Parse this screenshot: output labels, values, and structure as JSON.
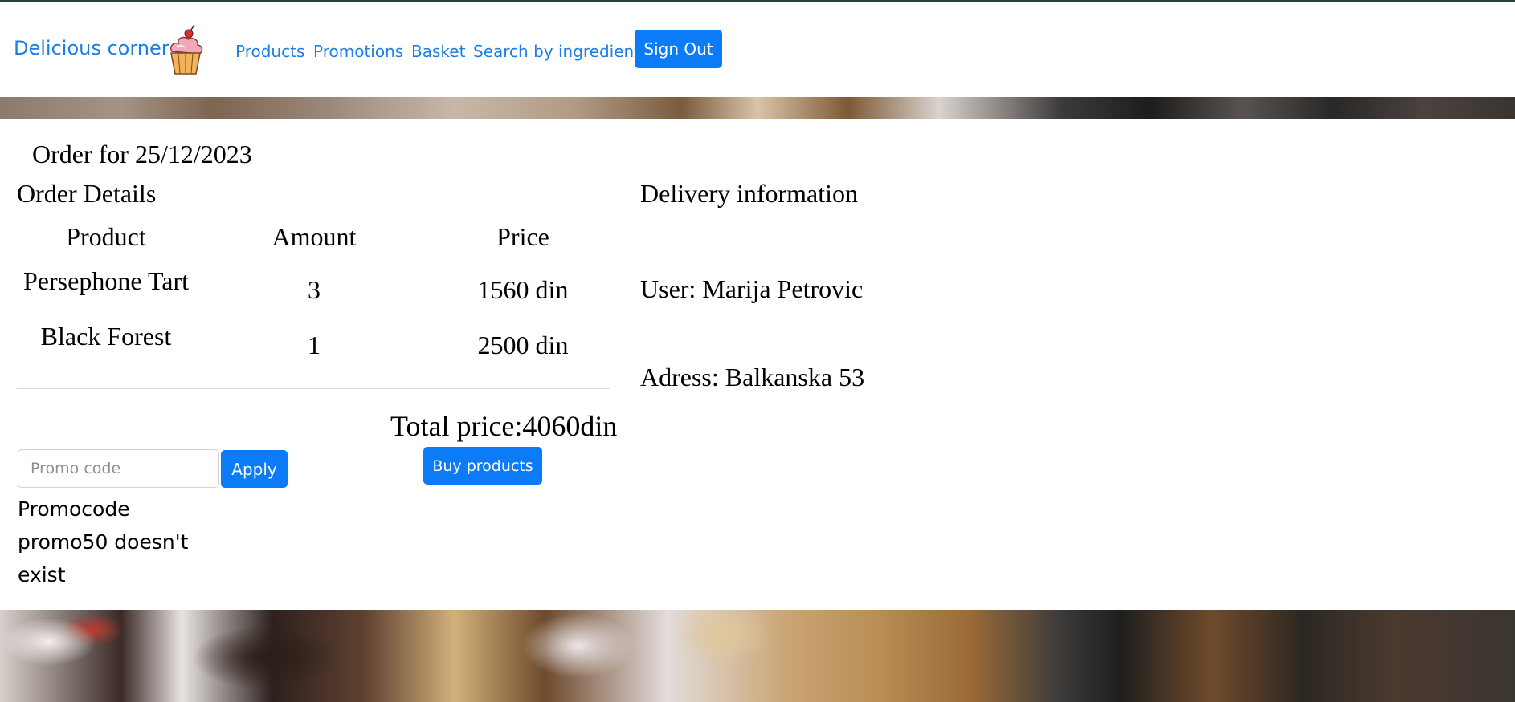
{
  "navbar": {
    "brand": "Delicious corner",
    "brand_logo_icon": "cupcake-icon",
    "links": [
      {
        "label": "Products"
      },
      {
        "label": "Promotions"
      },
      {
        "label": "Basket"
      },
      {
        "label": "Search by ingredients"
      }
    ],
    "sign_out": "Sign Out"
  },
  "order": {
    "title": "Order for 25/12/2023",
    "details_title": "Order Details",
    "columns": [
      "Product",
      "Amount",
      "Price"
    ],
    "rows": [
      {
        "product": "Persephone Tart",
        "amount": "3",
        "price": "1560 din"
      },
      {
        "product": "Black Forest",
        "amount": "1",
        "price": "2500 din"
      }
    ],
    "total_price": "Total price:4060din",
    "buy_button": "Buy products"
  },
  "promo": {
    "placeholder": "Promo code",
    "value": "",
    "apply_button": "Apply",
    "message": "Promocode promo50 doesn't exist"
  },
  "delivery": {
    "title": "Delivery information",
    "user": "User: Marija Petrovic",
    "address": "Adress: Balkanska 53"
  },
  "colors": {
    "accent": "#0b7bf7",
    "link": "#1e7ee6"
  }
}
